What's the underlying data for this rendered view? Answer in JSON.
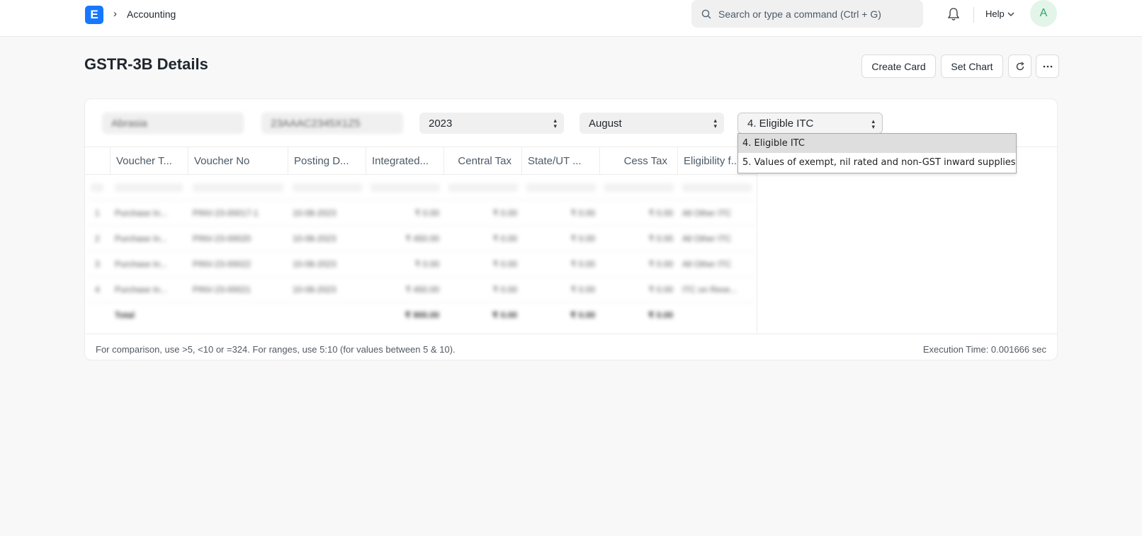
{
  "navbar": {
    "logo_letter": "E",
    "breadcrumb": "Accounting",
    "search_placeholder": "Search or type a command (Ctrl + G)",
    "help_label": "Help",
    "avatar_initial": "A"
  },
  "page": {
    "title": "GSTR-3B Details",
    "buttons": {
      "create_card": "Create Card",
      "set_chart": "Set Chart"
    }
  },
  "filters": {
    "company": "Abrasia",
    "gstin": "23AAAC2345X1Z5",
    "year": "2023",
    "month": "August",
    "type": "4. Eligible ITC"
  },
  "type_dropdown": {
    "options": [
      "4. Eligible ITC",
      "5. Values of exempt, nil rated and non-GST inward supplies"
    ],
    "selected_index": 0
  },
  "grid": {
    "columns": [
      "Voucher T...",
      "Voucher No",
      "Posting D...",
      "Integrated...",
      "Central Tax",
      "State/UT ...",
      "Cess Tax",
      "Eligibility f..."
    ],
    "rows": [
      {
        "no": "1",
        "voucher_type": "Purchase In...",
        "voucher_no": "PINV-23-00017-1",
        "posting_date": "10-08-2023",
        "integrated": "₹ 0.00",
        "central": "₹ 0.00",
        "state": "₹ 0.00",
        "cess": "₹ 0.00",
        "eligibility": "All Other ITC"
      },
      {
        "no": "2",
        "voucher_type": "Purchase In...",
        "voucher_no": "PINV-23-00020",
        "posting_date": "10-08-2023",
        "integrated": "₹ 450.00",
        "central": "₹ 0.00",
        "state": "₹ 0.00",
        "cess": "₹ 0.00",
        "eligibility": "All Other ITC"
      },
      {
        "no": "3",
        "voucher_type": "Purchase In...",
        "voucher_no": "PINV-23-00022",
        "posting_date": "10-08-2023",
        "integrated": "₹ 0.00",
        "central": "₹ 0.00",
        "state": "₹ 0.00",
        "cess": "₹ 0.00",
        "eligibility": "All Other ITC"
      },
      {
        "no": "4",
        "voucher_type": "Purchase In...",
        "voucher_no": "PINV-23-00021",
        "posting_date": "10-08-2023",
        "integrated": "₹ 450.00",
        "central": "₹ 0.00",
        "state": "₹ 0.00",
        "cess": "₹ 0.00",
        "eligibility": "ITC on Reve..."
      }
    ],
    "total": {
      "label": "Total",
      "integrated": "₹ 900.00",
      "central": "₹ 0.00",
      "state": "₹ 0.00",
      "cess": "₹ 0.00"
    }
  },
  "footer": {
    "hint": "For comparison, use >5, <10 or =324. For ranges, use 5:10 (for values between 5 & 10).",
    "execution_time": "Execution Time: 0.001666 sec"
  },
  "colors": {
    "brand": "#1778ff",
    "avatar_bg": "#e3f5e9",
    "avatar_fg": "#30a66d"
  }
}
